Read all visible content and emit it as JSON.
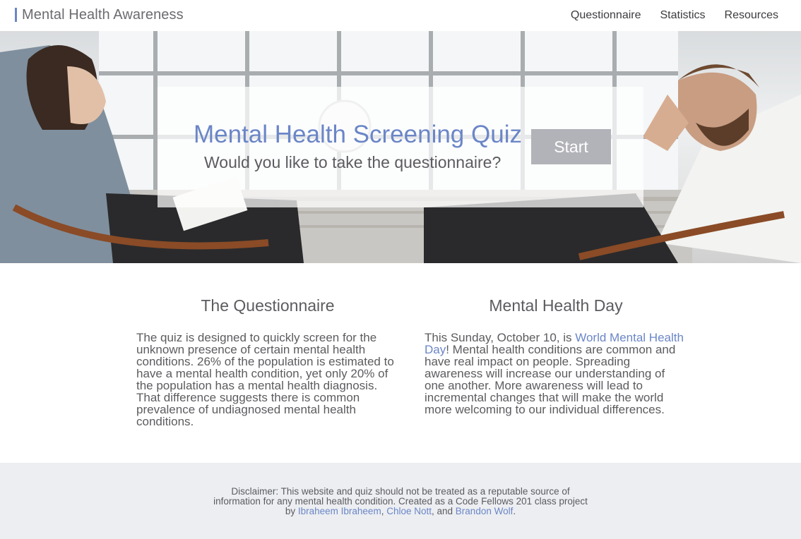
{
  "header": {
    "brand": "Mental Health Awareness",
    "nav": [
      "Questionnaire",
      "Statistics",
      "Resources"
    ]
  },
  "hero": {
    "title": "Mental Health Screening Quiz",
    "subtitle": "Would you like to take the questionnaire?",
    "start_label": "Start"
  },
  "sections": {
    "questionnaire": {
      "heading": "The Questionnaire",
      "body": "The quiz is designed to quickly screen for the unknown presence of certain mental health conditions. 26% of the population is estimated to have a mental health condition, yet only 20% of the population has a mental health diagnosis. That difference suggests there is common prevalence of undiagnosed mental health conditions."
    },
    "mental_health_day": {
      "heading": "Mental Health Day",
      "body_pre": "This Sunday, October 10, is ",
      "link": "World Mental Health Day",
      "body_post": "! Mental health conditions are common and have real impact on people. Spreading awareness will increase our understanding of one another. More awareness will lead to incremental changes that will make the world more welcoming to our individual differences."
    }
  },
  "footer": {
    "text_pre": "Disclaimer: This website and quiz should not be treated as a reputable source of information for any mental health condition. Created as a Code Fellows 201 class project by ",
    "author1": "Ibraheem Ibraheem",
    "sep1": ", ",
    "author2": "Chloe Nott",
    "sep2": ", and ",
    "author3": "Brandon Wolf",
    "text_post": "."
  },
  "colors": {
    "accent": "#6b86c7",
    "button": "#b1b3b8",
    "footer_bg": "#eceef1"
  }
}
